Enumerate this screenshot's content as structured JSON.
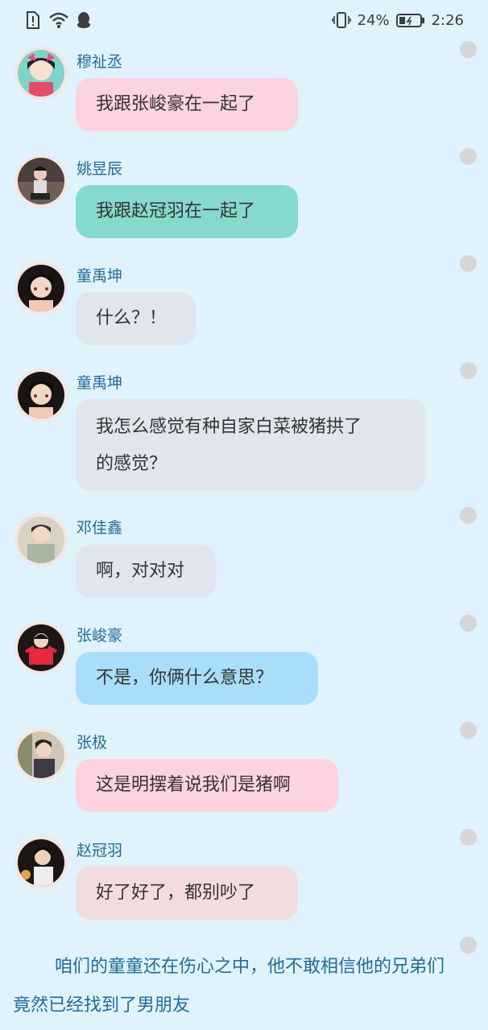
{
  "status_bar": {
    "battery_percent": "24%",
    "time": "2:26"
  },
  "colors": {
    "background": "#e0f2fb",
    "name_text": "#1f6d99",
    "bubble_pink": "#fdd3df",
    "bubble_teal": "#86d9cd",
    "bubble_gray": "#e0e5ee",
    "bubble_blue": "#a8def9",
    "bubble_rose": "#f3dcdf"
  },
  "messages": [
    {
      "name": "穆祉丞",
      "text": "我跟张峻豪在一起了"
    },
    {
      "name": "姚昱辰",
      "text": "我跟赵冠羽在一起了"
    },
    {
      "name": "童禹坤",
      "text": "什么？！"
    },
    {
      "name": "童禹坤",
      "text_line1": "我怎么感觉有种自家白菜被猪拱了",
      "text_line2": "的感觉？"
    },
    {
      "name": "邓佳鑫",
      "text": "啊，对对对"
    },
    {
      "name": "张峻豪",
      "text": "不是，你俩什么意思？"
    },
    {
      "name": "张极",
      "text": "这是明摆着说我们是猪啊"
    },
    {
      "name": "赵冠羽",
      "text": "好了好了，都别吵了"
    }
  ],
  "narration": "咱们的童童还在伤心之中，他不敢相信他的兄弟们竟然已经找到了男朋友"
}
